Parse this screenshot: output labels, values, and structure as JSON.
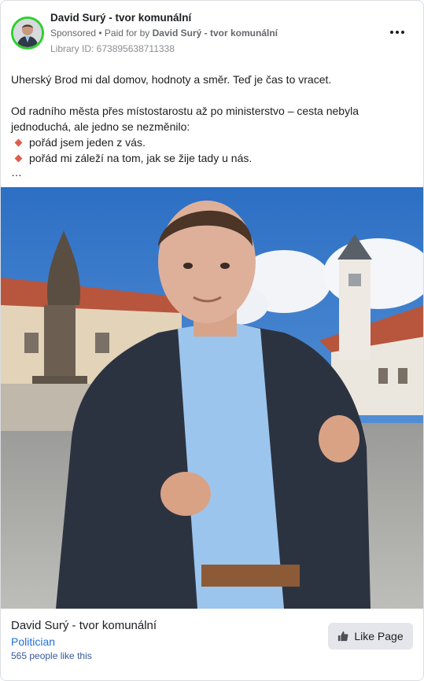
{
  "post": {
    "page_name": "David Surý - tvor komunální",
    "sponsored": "Sponsored",
    "paid_prefix": " • Paid for by ",
    "paid_by": "David Surý - tvor komunální",
    "library_id": "Library ID: 673895638711338",
    "more_icon": "more-dots-icon",
    "text": {
      "line1": "Uherský Brod mi dal domov, hodnoty a směr. Teď je čas to vracet.",
      "para2_line1": "Od radního města přes místostarostu až po ministerstvo – cesta nebyla",
      "para2_line2": "jednoduchá, ale jedno se nezměnilo:",
      "bullets": [
        "pořád jsem jeden z vás.",
        "pořád mi záleží na tom, jak se žije tady u nás."
      ],
      "ellipsis": "…"
    }
  },
  "footer": {
    "page_name": "David Surý - tvor komunální",
    "category": "Politician",
    "likes": "565 people like this",
    "like_button": "Like Page",
    "like_icon": "thumbs-up-icon"
  },
  "colors": {
    "avatar_ring": "#2ed02e",
    "bullet": "#e05d4a",
    "category_link": "#216fdb",
    "button_bg": "#e4e6eb"
  }
}
